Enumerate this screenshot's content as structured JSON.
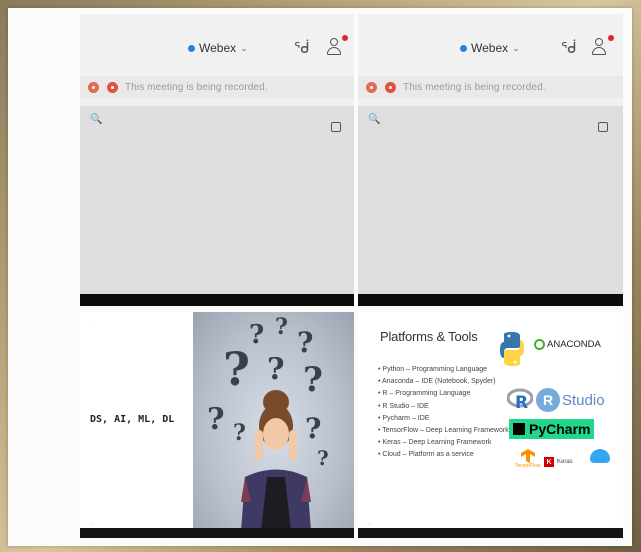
{
  "panels": {
    "webex_left": {
      "brand": "Webex",
      "recording_text": "This meeting is being recorded."
    },
    "webex_right": {
      "brand": "Webex",
      "recording_text": "This meeting is being recorded."
    },
    "slide_left": {
      "heading": "DS, AI, ML, DL",
      "question_marks": [
        "?",
        "?",
        "?",
        "?",
        "?",
        "?",
        "?",
        "?",
        "?",
        "?"
      ]
    },
    "slide_right": {
      "title": "Platforms & Tools",
      "items": [
        "• Python – Programming Language",
        "• Anaconda – IDE (Notebook, Spyder)",
        "• R – Programming Language",
        "• R Studio – IDE",
        "• Pycharm – IDE",
        "• TensorFlow – Deep Learning Framework",
        "• Keras – Deep Learning Framework",
        "• Cloud – Platform as a service"
      ],
      "logos": {
        "anaconda": "ANACONDA",
        "r": "R",
        "rstudio_ball": "R",
        "rstudio": "Studio",
        "pycharm": "PyCharm",
        "tensorflow": "TensorFlow",
        "keras": "Keras",
        "keras_k": "K"
      }
    }
  },
  "colors": {
    "webex_blue": "#2b7de9",
    "notification_red": "#e0222e",
    "recording_red": "#e0523e",
    "pycharm_green": "#21d789",
    "rstudio_blue": "#75aadb"
  },
  "icons": [
    "webex-dot-icon",
    "chevron-down-icon",
    "bluetooth-icon",
    "user-icon",
    "recording-icon",
    "zoom-icon",
    "minimize-icon",
    "python-icon",
    "cloud-icon"
  ]
}
